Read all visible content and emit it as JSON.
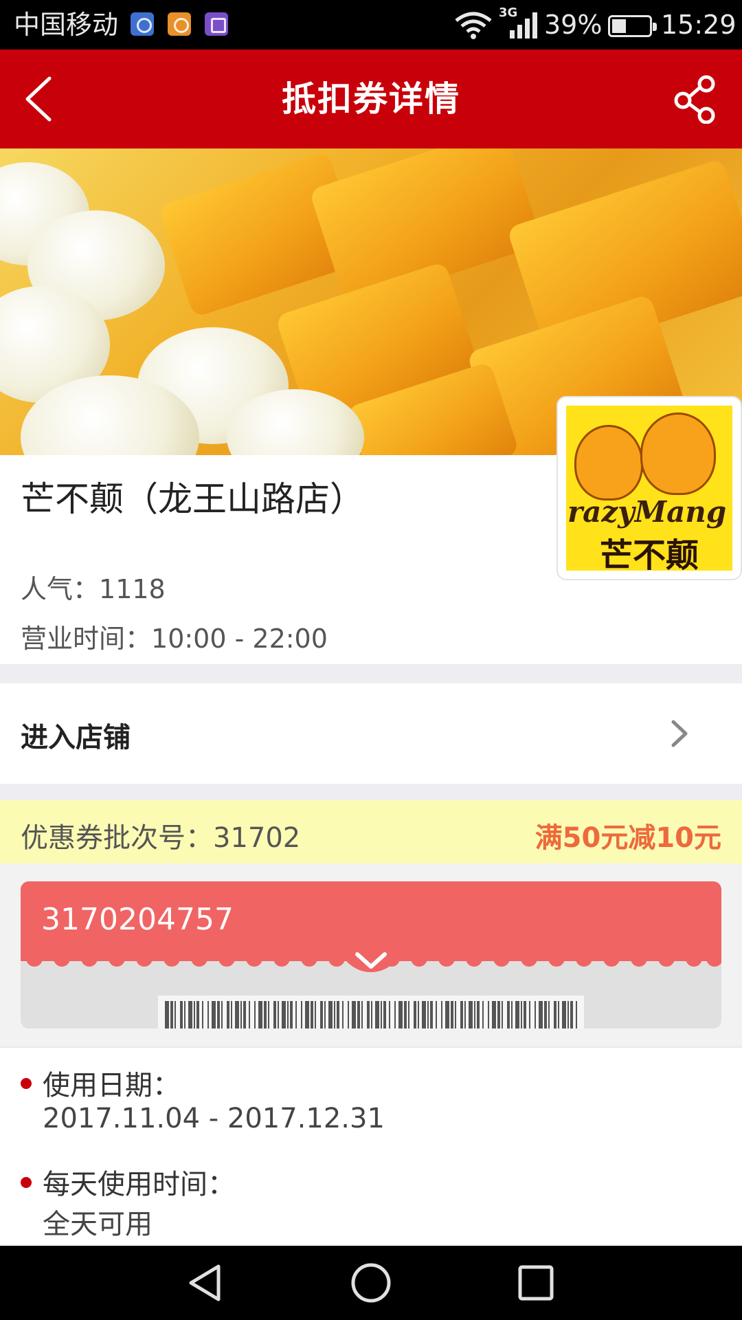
{
  "status_bar": {
    "carrier": "中国移动",
    "network": "3G",
    "battery": "39%",
    "time": "15:29",
    "app_icons": [
      "maps-icon",
      "health-icon",
      "gallery-icon"
    ]
  },
  "header": {
    "title": "抵扣券详情",
    "back_icon": "back-chevron-icon",
    "share_icon": "share-icon"
  },
  "shop": {
    "name": "芒不颠（龙王山路店）",
    "logo_brand": "razyMang",
    "logo_cn": "芒不颠",
    "popularity_label": "人气：",
    "popularity": "1118",
    "hours_label": "营业时间：",
    "hours": "10:00 - 22:00"
  },
  "enter_shop": {
    "label": "进入店铺"
  },
  "coupon": {
    "batch_label": "优惠券批次号：",
    "batch_no": "31702",
    "offer": "满50元减10元",
    "code": "3170204757"
  },
  "details": [
    {
      "label": "使用日期：",
      "value": "2017.11.04 - 2017.12.31"
    },
    {
      "label": "每天使用时间：",
      "value": "全天可用"
    }
  ],
  "colors": {
    "primary": "#c8000a",
    "coupon": "#f06464",
    "offer": "#ec6a3c",
    "batch_bg": "#fbfbb4"
  }
}
